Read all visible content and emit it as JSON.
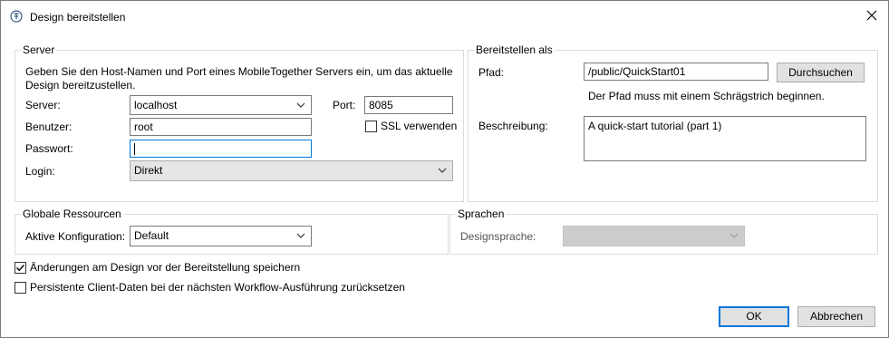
{
  "dialog": {
    "title": "Design bereitstellen"
  },
  "server_group": {
    "label": "Server",
    "description_line1": "Geben Sie den Host-Namen und Port eines MobileTogether Servers ein, um das aktuelle",
    "description_line2": "Design bereitzustellen.",
    "server_label": "Server:",
    "server_value": "localhost",
    "port_label": "Port:",
    "port_value": "8085",
    "user_label": "Benutzer:",
    "user_value": "root",
    "ssl_label": "SSL verwenden",
    "ssl_checked": false,
    "password_label": "Passwort:",
    "password_value": "",
    "login_label": "Login:",
    "login_value": "Direkt"
  },
  "deploy_group": {
    "label": "Bereitstellen als",
    "path_label": "Pfad:",
    "path_value": "/public/QuickStart01",
    "browse_button": "Durchsuchen",
    "path_hint": "Der Pfad muss mit einem Schrägstrich beginnen.",
    "description_label": "Beschreibung:",
    "description_value": "A quick-start tutorial (part 1)"
  },
  "global_resources": {
    "label": "Globale Ressourcen",
    "config_label": "Aktive Konfiguration:",
    "config_value": "Default"
  },
  "languages": {
    "label": "Sprachen",
    "design_language_label": "Designsprache:",
    "design_language_value": ""
  },
  "options": {
    "save_changes_label": "Änderungen am Design vor der Bereitstellung speichern",
    "save_changes_checked": true,
    "reset_client_label": "Persistente Client-Daten bei der nächsten Workflow-Ausführung zurücksetzen",
    "reset_client_checked": false
  },
  "footer": {
    "ok_button": "OK",
    "cancel_button": "Abbrechen"
  },
  "colors": {
    "focus_border": "#0078d7",
    "group_border": "#dcdcdc",
    "button_bg": "#e1e1e1"
  }
}
